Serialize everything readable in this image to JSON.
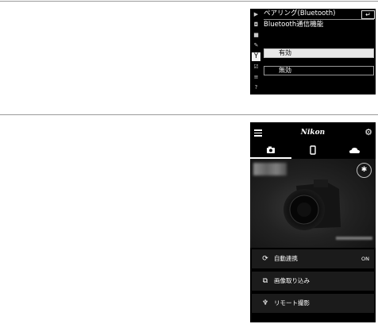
{
  "camera_menu": {
    "title": "ペアリング(Bluetooth)",
    "back_icon": "↵",
    "subtitle": "Bluetooth通信機能",
    "options": [
      {
        "label": "有効",
        "selected": true
      },
      {
        "label": "無効",
        "selected": false
      }
    ],
    "side_icons": [
      "playback-icon",
      "camera-icon",
      "movie-icon",
      "pencil-icon",
      "wrench-icon",
      "retouch-icon",
      "mymenu-icon",
      "help-icon"
    ]
  },
  "app": {
    "brand": "Nikon",
    "tabs": [
      {
        "icon": "camera-icon",
        "active": true
      },
      {
        "icon": "smartphone-icon",
        "active": false
      },
      {
        "icon": "cloud-icon",
        "active": false
      }
    ],
    "rows": [
      {
        "label": "自動連携",
        "value": "ON",
        "icon": "sync-icon"
      },
      {
        "label": "画像取り込み",
        "value": "",
        "icon": "import-icon"
      },
      {
        "label": "リモート撮影",
        "value": "",
        "icon": "remote-icon"
      }
    ]
  },
  "colors": {
    "background": "#000000",
    "accent": "#ffffff"
  }
}
